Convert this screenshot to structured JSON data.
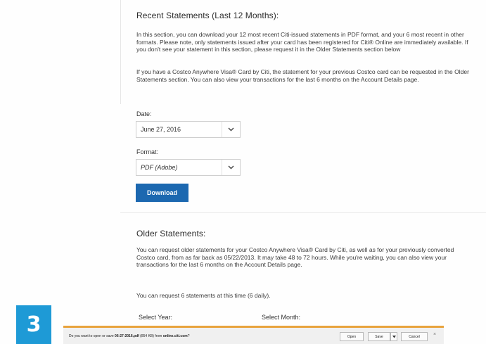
{
  "recent": {
    "title": "Recent Statements (Last 12 Months):",
    "para1": "In this section, you can download your 12 most recent Citi-issued statements in PDF format, and your 6 most recent in other formats. Please note, only statements issued after your card has been registered for Citi® Online are immediately available. If you don't see your statement in this section, please request it in the Older Statements section below",
    "para2": "If you have a Costco Anywhere Visa® Card by Citi, the statement for your previous Costco card can be requested in the Older Statements section. You can also view your transactions for the last 6 months on the Account Details page."
  },
  "form": {
    "date_label": "Date:",
    "date_value": "June 27, 2016",
    "format_label": "Format:",
    "format_value": "PDF (Adobe)",
    "download_label": "Download"
  },
  "older": {
    "title": "Older Statements:",
    "para1": "You can request older statements for your Costco Anywhere Visa® Card by Citi, as well as for your previously converted Costco card, from as far back as 05/22/2013. It may take 48 to 72 hours. While you're waiting, you can also view your transactions for the last 6 months on the Account Details page.",
    "para2": "You can request 6 statements at this time (6 daily).",
    "year_label": "Select Year:",
    "month_label": "Select Month:"
  },
  "badge": {
    "number": "3"
  },
  "download_bar": {
    "prompt_prefix": "Do you want to open or save ",
    "filename": "06-27-2016.pdf",
    "size": " (854 KB) from ",
    "host": "online.citi.com",
    "suffix": "?",
    "open_label": "Open",
    "save_label": "Save",
    "cancel_label": "Cancel",
    "close_glyph": "×"
  },
  "colors": {
    "primary_button": "#1c68b0",
    "badge": "#1e9ad6",
    "bar_accent": "#e8a33d"
  },
  "icons": {
    "select_arrow": "chevron-down-icon",
    "save_split": "caret-down-icon",
    "close": "close-icon"
  }
}
